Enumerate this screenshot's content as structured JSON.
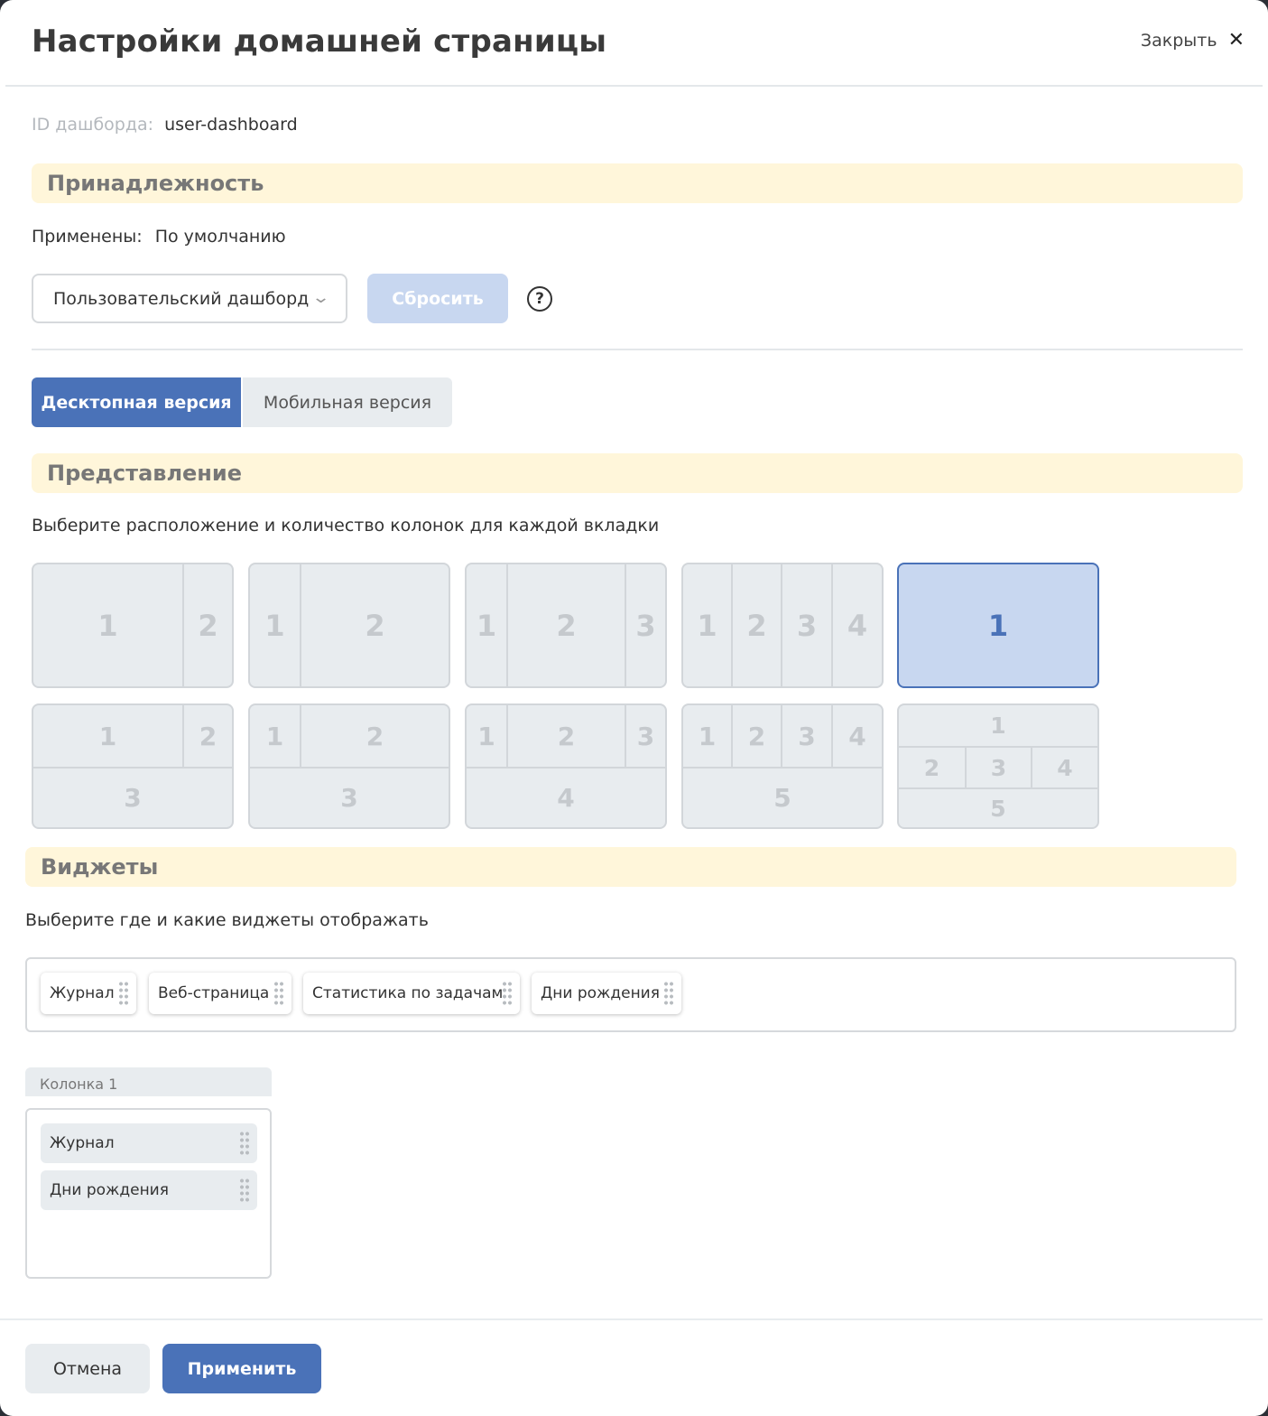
{
  "header": {
    "title": "Настройки домашней страницы",
    "close_label": "Закрыть"
  },
  "dashboard": {
    "id_label": "ID дашборда:",
    "id_value": "user-dashboard"
  },
  "membership": {
    "section_title": "Принадлежность",
    "applied_label": "Применены:",
    "applied_value": "По умолчанию",
    "select_value": "Пользовательский дашборд",
    "reset_label": "Сбросить"
  },
  "tabs": [
    {
      "label": "Десктопная версия",
      "active": true
    },
    {
      "label": "Мобильная версия",
      "active": false
    }
  ],
  "view": {
    "section_title": "Представление",
    "hint": "Выберите расположение и количество колонок для каждой вкладки",
    "layouts": [
      {
        "labels": [
          "1",
          "2"
        ]
      },
      {
        "labels": [
          "1",
          "2"
        ]
      },
      {
        "labels": [
          "1",
          "2",
          "3"
        ]
      },
      {
        "labels": [
          "1",
          "2",
          "3",
          "4"
        ]
      },
      {
        "labels": [
          "1"
        ],
        "selected": true
      },
      {
        "labels": [
          "1",
          "2",
          "3"
        ]
      },
      {
        "labels": [
          "1",
          "2",
          "3"
        ]
      },
      {
        "labels": [
          "1",
          "2",
          "3",
          "4"
        ]
      },
      {
        "labels": [
          "1",
          "2",
          "3",
          "4",
          "5"
        ]
      },
      {
        "labels": [
          "1",
          "2",
          "3",
          "4",
          "5"
        ]
      }
    ]
  },
  "widgets": {
    "section_title": "Виджеты",
    "hint": "Выберите где и какие виджеты отображать",
    "available": [
      "Журнал",
      "Веб-страница",
      "Статистика по задачам",
      "Дни рождения"
    ],
    "column": {
      "title": "Колонка 1",
      "items": [
        "Журнал",
        "Дни рождения"
      ]
    }
  },
  "footer": {
    "cancel_label": "Отмена",
    "apply_label": "Применить"
  },
  "colors": {
    "accent": "#4a72b8",
    "section_bg": "#fff6da",
    "neutral_bg": "#e8ecef"
  }
}
